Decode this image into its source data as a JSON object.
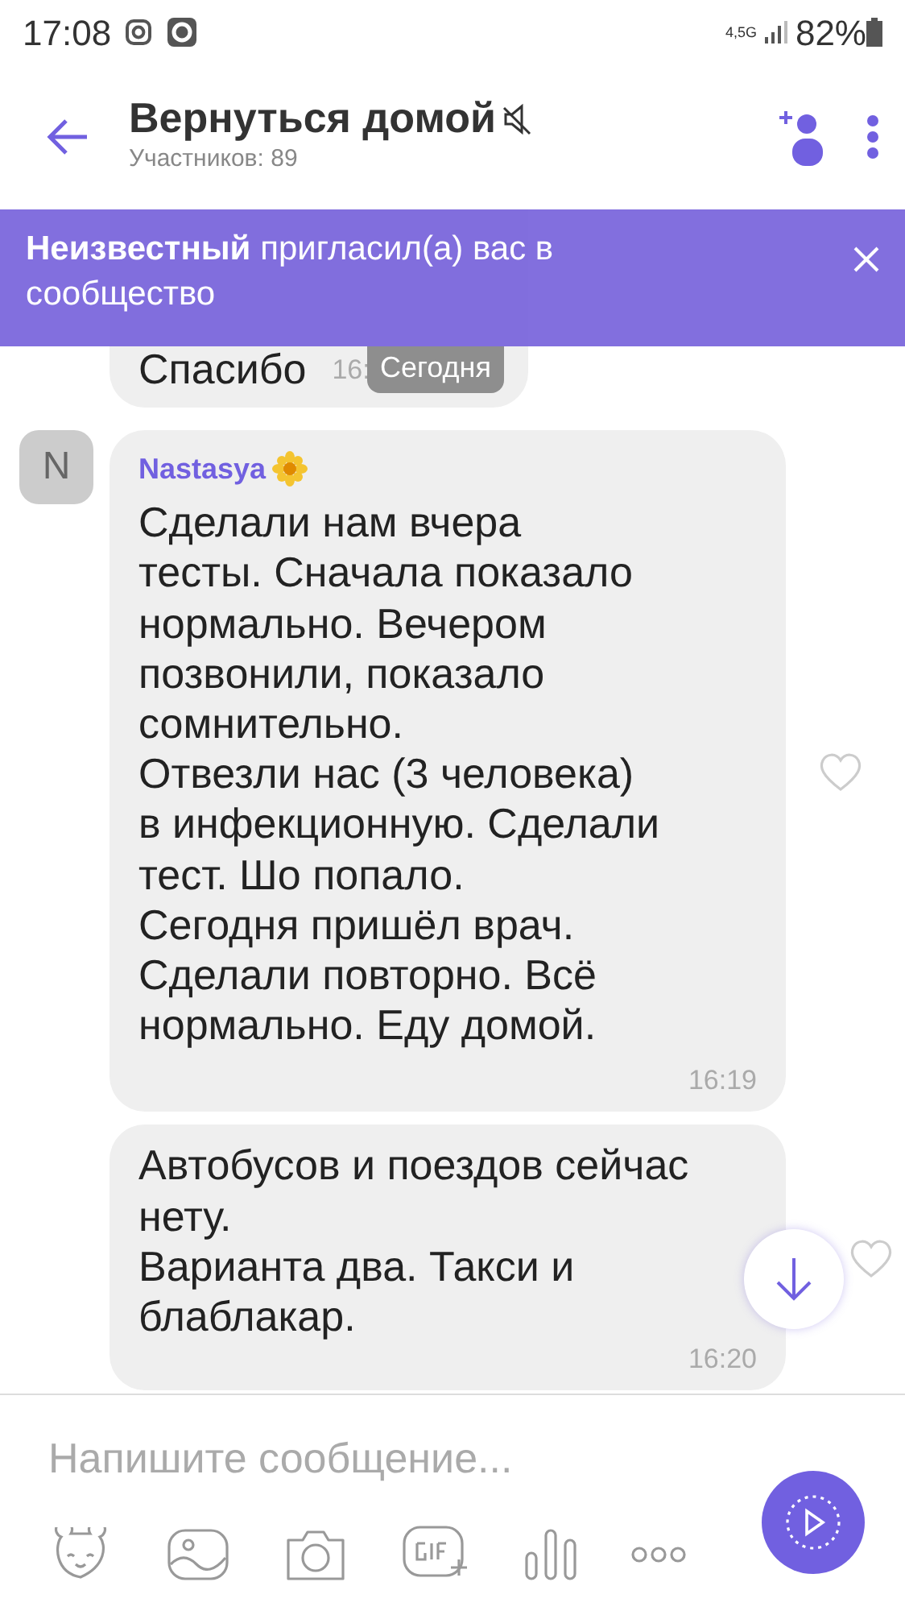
{
  "status_bar": {
    "time": "17:08",
    "network": "4,5G",
    "battery": "82%"
  },
  "header": {
    "title": "Вернуться домой",
    "muted": true,
    "subtitle": "Участников: 89"
  },
  "banner": {
    "text": "**Неизвестный** пригласил(а) вас в сообщество"
  },
  "date_pill": "Сегодня",
  "messages": [
    {
      "kind": "partial",
      "text": "Спасибо",
      "time": "16:"
    },
    {
      "kind": "full",
      "avatar": "N",
      "sender": "Nastasya",
      "text": "Сделали нам вчера\nтесты. Сначала показало\nнормально. Вечером\nпозвонили, показало\nсомнительно.\nОтвезли нас (3 человека)\nв инфекционную. Сделали\nтест. Шо попало.\nСегодня пришёл врач.\nСделали повторно. Всё\nнормально. Еду домой.",
      "time": "16:19"
    },
    {
      "kind": "plain",
      "text": "Автобусов и поездов сейчас\nнету.\nВарианта два. Такси и\nблаблакар.",
      "time": "16:20"
    }
  ],
  "composer": {
    "placeholder": "Напишите сообщение..."
  }
}
